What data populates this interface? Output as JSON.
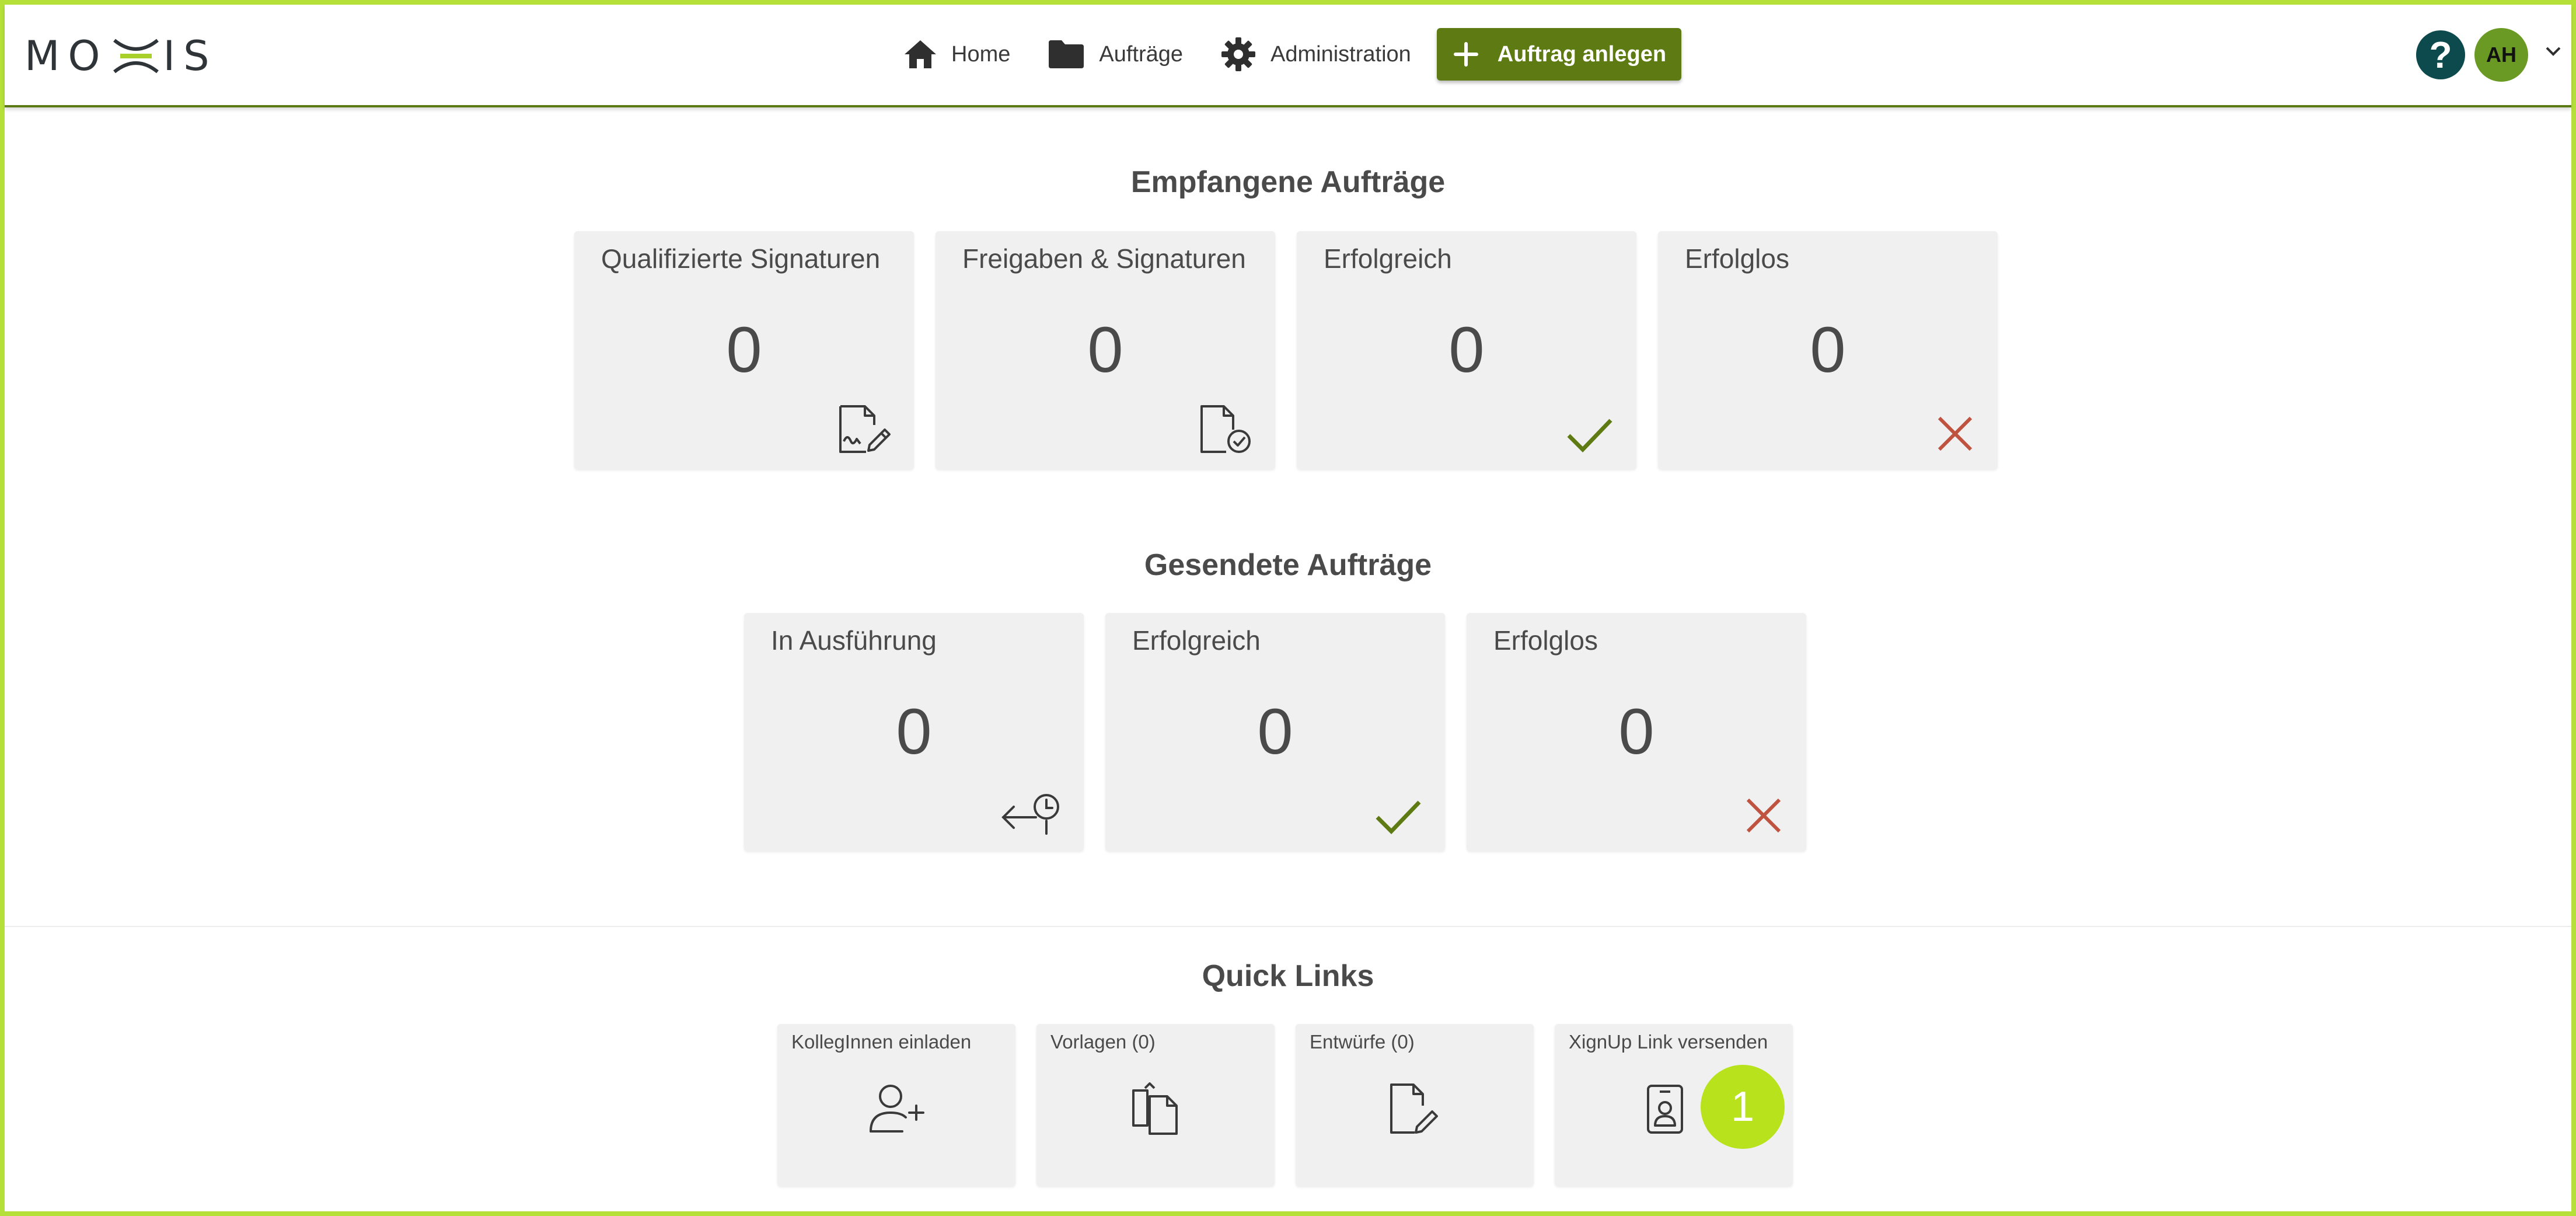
{
  "app": {
    "logo_text": "MOXIS"
  },
  "header": {
    "nav": {
      "home": "Home",
      "auftraege": "Aufträge",
      "administration": "Administration"
    },
    "new_order_label": "Auftrag anlegen",
    "help_label": "?",
    "avatar_initials": "AH"
  },
  "received": {
    "title": "Empfangene Aufträge",
    "cards": [
      {
        "label": "Qualifizierte Signaturen",
        "count": "0",
        "icon": "signature-doc-icon"
      },
      {
        "label": "Freigaben & Signaturen",
        "count": "0",
        "icon": "approval-doc-icon"
      },
      {
        "label": "Erfolgreich",
        "count": "0",
        "icon": "check-icon"
      },
      {
        "label": "Erfolglos",
        "count": "0",
        "icon": "cross-icon"
      }
    ]
  },
  "sent": {
    "title": "Gesendete Aufträge",
    "cards": [
      {
        "label": "In Ausführung",
        "count": "0",
        "icon": "pending-icon"
      },
      {
        "label": "Erfolgreich",
        "count": "0",
        "icon": "check-icon"
      },
      {
        "label": "Erfolglos",
        "count": "0",
        "icon": "cross-icon"
      }
    ]
  },
  "quick_links": {
    "title": "Quick Links",
    "items": [
      {
        "label": "KollegInnen einladen",
        "icon": "add-user-icon"
      },
      {
        "label": "Vorlagen (0)",
        "icon": "templates-icon"
      },
      {
        "label": "Entwürfe (0)",
        "icon": "draft-icon"
      },
      {
        "label": "XignUp Link versenden",
        "icon": "id-badge-icon"
      }
    ]
  },
  "step_badge": "1",
  "colors": {
    "accent_green": "#5e7a12",
    "success_green": "#5e7a12",
    "error_red": "#c0533f",
    "frame_lime": "#b5e03a",
    "badge_lime": "#b8e21c",
    "help_teal": "#0d4a4d"
  }
}
